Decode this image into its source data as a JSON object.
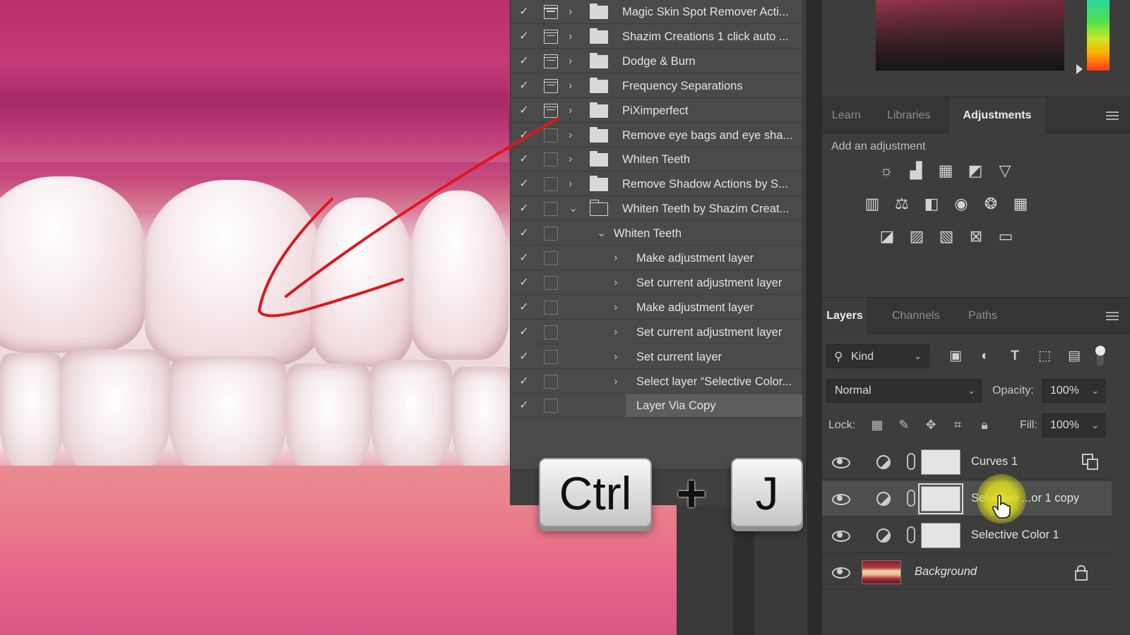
{
  "actions_panel": {
    "rows": [
      {
        "label": "Magic Skin Spot Remover Acti...",
        "type": "set"
      },
      {
        "label": "Shazim Creations 1 click auto ...",
        "type": "set"
      },
      {
        "label": "Dodge & Burn",
        "type": "set"
      },
      {
        "label": "Frequency Separations",
        "type": "set"
      },
      {
        "label": "PiXimperfect",
        "type": "set"
      },
      {
        "label": "Remove eye bags and eye sha...",
        "type": "set"
      },
      {
        "label": "Whiten Teeth",
        "type": "set"
      },
      {
        "label": "Remove Shadow Actions by S...",
        "type": "set"
      },
      {
        "label": "Whiten Teeth by Shazim Creat...",
        "type": "set-open"
      },
      {
        "label": "Whiten Teeth",
        "type": "action-open"
      },
      {
        "label": "Make adjustment layer",
        "type": "step"
      },
      {
        "label": "Set current adjustment layer",
        "type": "step"
      },
      {
        "label": "Make adjustment layer",
        "type": "step"
      },
      {
        "label": "Set current adjustment layer",
        "type": "step"
      },
      {
        "label": "Set current layer",
        "type": "step"
      },
      {
        "label": "Select layer “Selective Color...",
        "type": "step"
      },
      {
        "label": "Layer Via Copy",
        "type": "step-selected"
      }
    ],
    "check_glyph": "✓"
  },
  "shortcut": {
    "key1": "Ctrl",
    "plus": "+",
    "key2": "J"
  },
  "adjustments_tabs": {
    "learn": "Learn",
    "libraries": "Libraries",
    "adjustments": "Adjustments",
    "hint": "Add an adjustment",
    "icons_row1": [
      "brightness-contrast-icon",
      "levels-icon",
      "curves-icon",
      "exposure-icon",
      "vibrance-icon"
    ],
    "icons_row2": [
      "hue-saturation-icon",
      "color-balance-icon",
      "black-white-icon",
      "photo-filter-icon",
      "channel-mixer-icon",
      "color-lookup-icon"
    ],
    "icons_row3": [
      "invert-icon",
      "posterize-icon",
      "threshold-icon",
      "selective-color-icon",
      "gradient-map-icon"
    ]
  },
  "layers_tabs": {
    "layers": "Layers",
    "channels": "Channels",
    "paths": "Paths"
  },
  "layers_controls": {
    "filter_kind": "Kind",
    "blend_mode": "Normal",
    "opacity_label": "Opacity:",
    "opacity_value": "100%",
    "lock_label": "Lock:",
    "fill_label": "Fill:",
    "fill_value": "100%"
  },
  "layers": [
    {
      "name": "Curves 1",
      "selected": false
    },
    {
      "name": "Selective ...or 1 copy",
      "selected": true
    },
    {
      "name": "Selective Color 1",
      "selected": false
    },
    {
      "name": "Background",
      "selected": false
    }
  ],
  "colors": {
    "panel_bg": "#4a4a4a",
    "cursor_highlight": "#e6e628",
    "annotation_red": "#e0141c"
  }
}
